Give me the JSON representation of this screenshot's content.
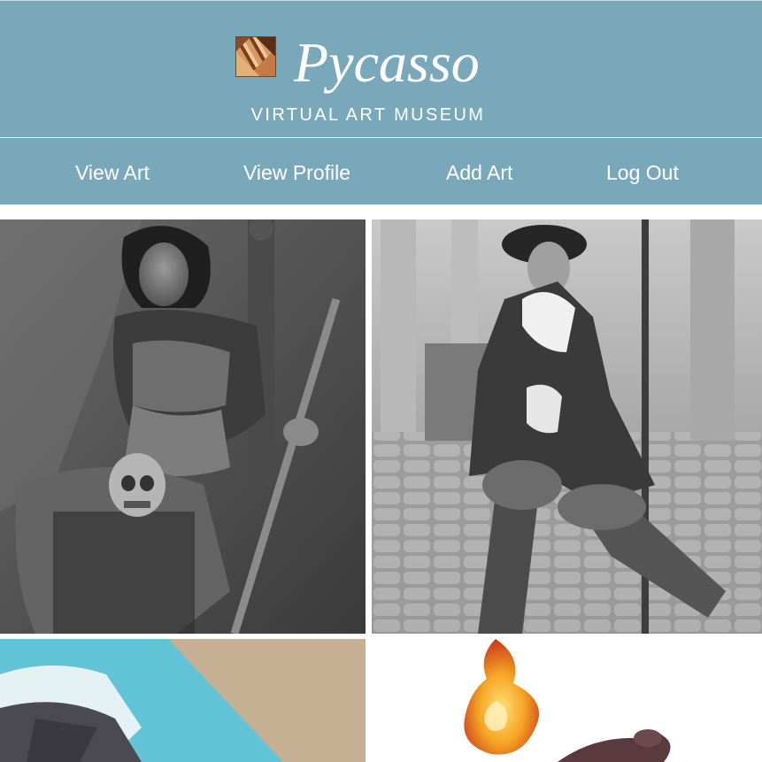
{
  "header": {
    "title": "Pycasso",
    "subtitle": "VIRTUAL ART MUSEUM",
    "logo_icon": "mosaic-logo-icon",
    "background_color": "#7aa8bb"
  },
  "nav": {
    "items": [
      {
        "label": "View Art"
      },
      {
        "label": "View Profile"
      },
      {
        "label": "Add Art"
      },
      {
        "label": "Log Out"
      }
    ]
  },
  "gallery": {
    "artworks": [
      {
        "subject": "grayscale painting of seated warrior woman holding skull and staff"
      },
      {
        "subject": "grayscale painting of smiling figure in cloak and wide-brim hat holding pole"
      },
      {
        "subject": "colorful low-poly illustration in blue and tan"
      },
      {
        "subject": "painting of burning flame on dark object"
      }
    ]
  }
}
